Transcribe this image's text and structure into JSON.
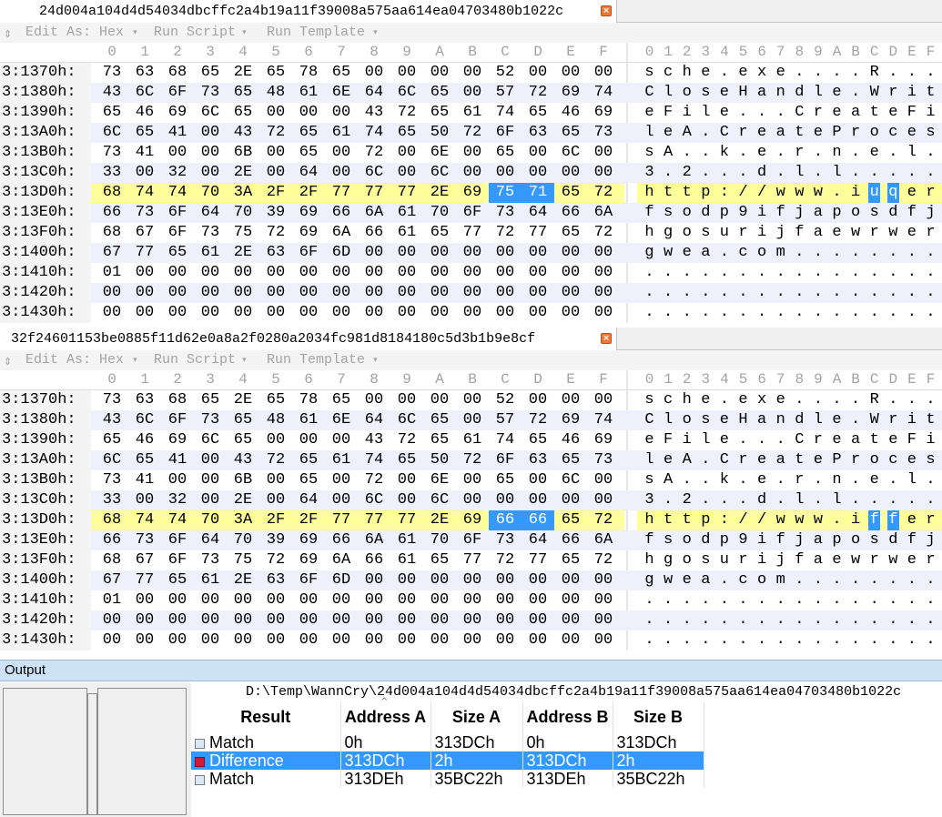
{
  "pane_top": {
    "tab_title": "24d004a104d4d54034dbcffc2a4b19a11f39008a575aa614ea04703480b1022c",
    "selection_hex": [
      "75",
      "71"
    ],
    "selection_ascii": [
      "u",
      "q"
    ]
  },
  "pane_bottom": {
    "tab_title": "32f24601153be0885f11d62e0a8a2f0280a2034fc981d8184180c5d3b1b9e8cf",
    "selection_hex": [
      "66",
      "66"
    ],
    "selection_ascii": [
      "f",
      "f"
    ]
  },
  "toolbar": {
    "edit_as": "Edit As: Hex",
    "run_script": "Run Script",
    "run_template": "Run Template",
    "caret": "▾",
    "grip": "⇕"
  },
  "column_headers": {
    "hex": [
      "0",
      "1",
      "2",
      "3",
      "4",
      "5",
      "6",
      "7",
      "8",
      "9",
      "A",
      "B",
      "C",
      "D",
      "E",
      "F"
    ],
    "ascii": "0123456789ABCDEF"
  },
  "rows": [
    {
      "addr": "3:1370h:",
      "hex": [
        "73",
        "63",
        "68",
        "65",
        "2E",
        "65",
        "78",
        "65",
        "00",
        "00",
        "00",
        "00",
        "52",
        "00",
        "00",
        "00"
      ],
      "ascii": "sche.exe....R..."
    },
    {
      "addr": "3:1380h:",
      "hex": [
        "43",
        "6C",
        "6F",
        "73",
        "65",
        "48",
        "61",
        "6E",
        "64",
        "6C",
        "65",
        "00",
        "57",
        "72",
        "69",
        "74"
      ],
      "ascii": "CloseHandle.Writ"
    },
    {
      "addr": "3:1390h:",
      "hex": [
        "65",
        "46",
        "69",
        "6C",
        "65",
        "00",
        "00",
        "00",
        "43",
        "72",
        "65",
        "61",
        "74",
        "65",
        "46",
        "69"
      ],
      "ascii": "eFile...CreateFi"
    },
    {
      "addr": "3:13A0h:",
      "hex": [
        "6C",
        "65",
        "41",
        "00",
        "43",
        "72",
        "65",
        "61",
        "74",
        "65",
        "50",
        "72",
        "6F",
        "63",
        "65",
        "73"
      ],
      "ascii": "leA.CreateProces"
    },
    {
      "addr": "3:13B0h:",
      "hex": [
        "73",
        "41",
        "00",
        "00",
        "6B",
        "00",
        "65",
        "00",
        "72",
        "00",
        "6E",
        "00",
        "65",
        "00",
        "6C",
        "00"
      ],
      "ascii": "sA..k.e.r.n.e.l."
    },
    {
      "addr": "3:13C0h:",
      "hex": [
        "33",
        "00",
        "32",
        "00",
        "2E",
        "00",
        "64",
        "00",
        "6C",
        "00",
        "6C",
        "00",
        "00",
        "00",
        "00",
        "00"
      ],
      "ascii": "3.2...d.l.l....."
    },
    {
      "addr": "3:13D0h:",
      "hex": [
        "68",
        "74",
        "74",
        "70",
        "3A",
        "2F",
        "2F",
        "77",
        "77",
        "77",
        "2E",
        "69",
        "75",
        "71",
        "65",
        "72"
      ],
      "ascii": "http://www.iuqer",
      "highlight": true
    },
    {
      "addr": "3:13E0h:",
      "hex": [
        "66",
        "73",
        "6F",
        "64",
        "70",
        "39",
        "69",
        "66",
        "6A",
        "61",
        "70",
        "6F",
        "73",
        "64",
        "66",
        "6A"
      ],
      "ascii": "fsodp9ifjaposdfj"
    },
    {
      "addr": "3:13F0h:",
      "hex": [
        "68",
        "67",
        "6F",
        "73",
        "75",
        "72",
        "69",
        "6A",
        "66",
        "61",
        "65",
        "77",
        "72",
        "77",
        "65",
        "72"
      ],
      "ascii": "hgosurijfaewrwer"
    },
    {
      "addr": "3:1400h:",
      "hex": [
        "67",
        "77",
        "65",
        "61",
        "2E",
        "63",
        "6F",
        "6D",
        "00",
        "00",
        "00",
        "00",
        "00",
        "00",
        "00",
        "00"
      ],
      "ascii": "gwea.com........"
    },
    {
      "addr": "3:1410h:",
      "hex": [
        "01",
        "00",
        "00",
        "00",
        "00",
        "00",
        "00",
        "00",
        "00",
        "00",
        "00",
        "00",
        "00",
        "00",
        "00",
        "00"
      ],
      "ascii": "................"
    },
    {
      "addr": "3:1420h:",
      "hex": [
        "00",
        "00",
        "00",
        "00",
        "00",
        "00",
        "00",
        "00",
        "00",
        "00",
        "00",
        "00",
        "00",
        "00",
        "00",
        "00"
      ],
      "ascii": "................"
    },
    {
      "addr": "3:1430h:",
      "hex": [
        "00",
        "00",
        "00",
        "00",
        "00",
        "00",
        "00",
        "00",
        "00",
        "00",
        "00",
        "00",
        "00",
        "00",
        "00",
        "00"
      ],
      "ascii": "................"
    }
  ],
  "output": {
    "label": "Output",
    "compare_path": "D:\\Temp\\WannCry\\24d004a104d4d54034dbcffc2a4b19a11f39008a575aa614ea04703480b1022c",
    "sort_arrow": "^",
    "columns": [
      "Result",
      "Address A",
      "Size A",
      "Address B",
      "Size B"
    ],
    "results": [
      {
        "result": "Match",
        "address_a": "0h",
        "size_a": "313DCh",
        "address_b": "0h",
        "size_b": "313DCh",
        "kind": "match"
      },
      {
        "result": "Difference",
        "address_a": "313DCh",
        "size_a": "2h",
        "address_b": "313DCh",
        "size_b": "2h",
        "kind": "difference",
        "selected": true
      },
      {
        "result": "Match",
        "address_a": "313DEh",
        "size_a": "35BC22h",
        "address_b": "313DEh",
        "size_b": "35BC22h",
        "kind": "match"
      }
    ]
  },
  "colors": {
    "selection": "#3399ff",
    "highlight_row": "#ffff99",
    "difference_marker": "#d8163a",
    "output_bar": "#cde3f5"
  }
}
